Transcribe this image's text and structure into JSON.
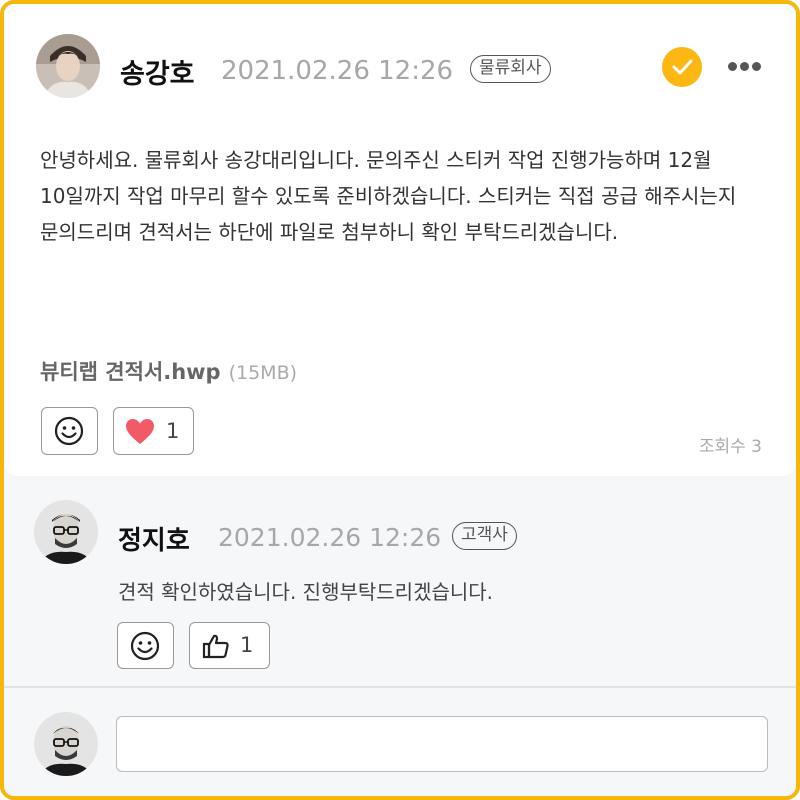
{
  "post": {
    "author": "송강호",
    "timestamp": "2021.02.26 12:26",
    "company_tag": "물류회사",
    "body": "안녕하세요. 물류회사 송강대리입니다. 문의주신 스티커 작업 진행가능하며 12월 10일까지 작업 마무리 할수 있도록 준비하겠습니다. 스티커는 직접 공급 해주시는지 문의드리며 견적서는 하단에 파일로 첨부하니 확인 부탁드리겠습니다.",
    "attachment": {
      "name": "뷰티랩 견적서.hwp",
      "size": "(15MB)"
    },
    "like_count": "1",
    "views": "조회수 3",
    "icons": [
      "avatar-photo",
      "check-icon",
      "more-icon",
      "smiley-icon",
      "heart-icon"
    ],
    "colors": {
      "accent": "#f5b70a",
      "check": "#fcb713",
      "heart": "#f25a67"
    }
  },
  "comment": {
    "author": "정지호",
    "timestamp": "2021.02.26 12:26",
    "company_tag": "고객사",
    "text": "견적 확인하였습니다. 진행부탁드리겠습니다.",
    "like_count": "1",
    "icons": [
      "avatar-photo",
      "smiley-icon",
      "thumbs-up-icon"
    ]
  },
  "reply": {
    "value": "",
    "placeholder": ""
  }
}
